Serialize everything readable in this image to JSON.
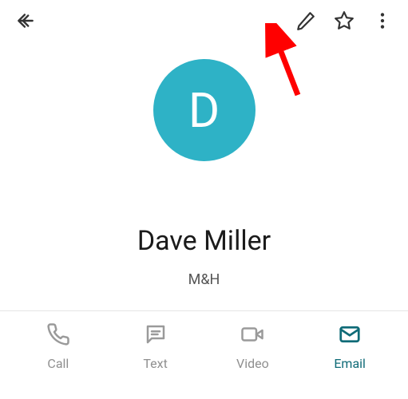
{
  "contact": {
    "initial": "D",
    "name": "Dave Miller",
    "company": "M&H",
    "avatar_bg": "#2eb2c6"
  },
  "topbar": {
    "back": "back-icon",
    "edit": "pencil-icon",
    "favorite": "star-icon",
    "overflow": "more-icon"
  },
  "actions": [
    {
      "key": "call",
      "label": "Call",
      "icon": "phone-icon",
      "active": false
    },
    {
      "key": "text",
      "label": "Text",
      "icon": "message-icon",
      "active": false
    },
    {
      "key": "video",
      "label": "Video",
      "icon": "video-icon",
      "active": false
    },
    {
      "key": "email",
      "label": "Email",
      "icon": "mail-icon",
      "active": true
    }
  ],
  "annotation": {
    "arrow_target": "edit-button",
    "arrow_color": "#ff0000"
  }
}
